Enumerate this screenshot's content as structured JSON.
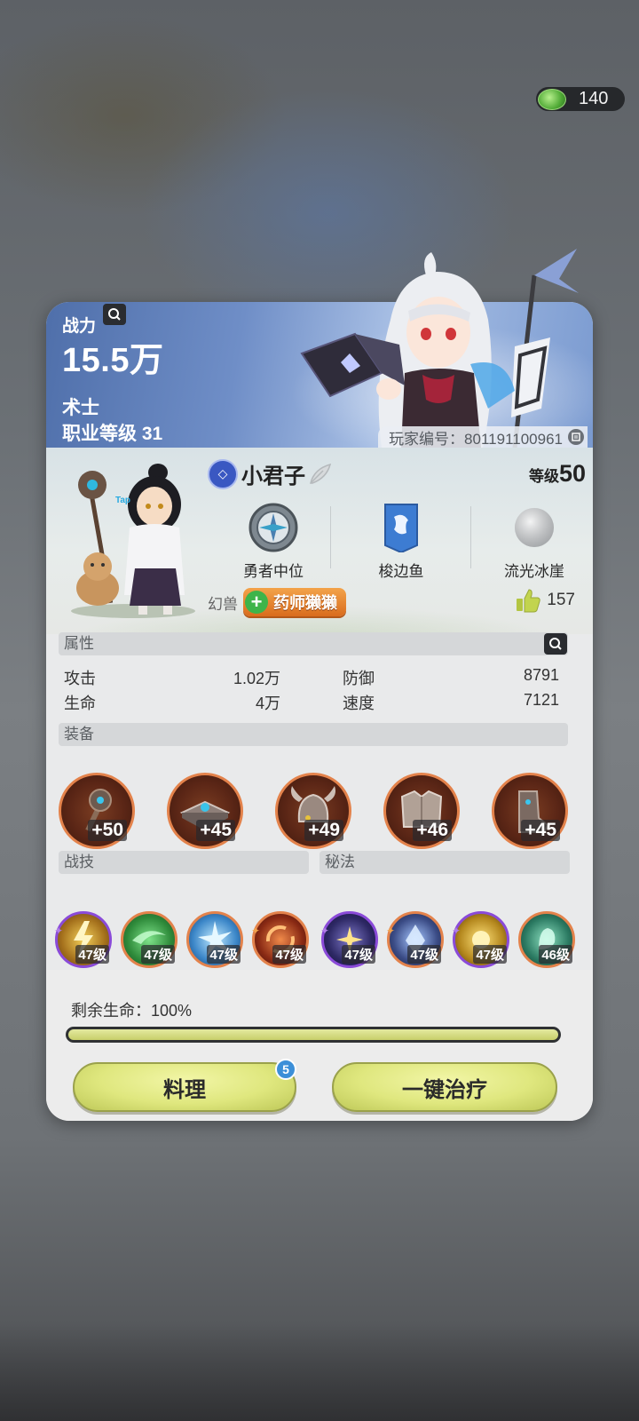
{
  "currency": {
    "amount": "140",
    "icon": "leaf-currency-icon"
  },
  "banner": {
    "power_label": "战力",
    "power_value": "15.5万",
    "class_name": "术士",
    "class_level": "职业等级 31",
    "player_id": "玩家编号：801191100961"
  },
  "profile": {
    "name": "小君子",
    "level_label": "等级",
    "level_value": "50",
    "badges": [
      {
        "label": "勇者中位",
        "icon": "rank-emblem-icon"
      },
      {
        "label": "梭边鱼",
        "icon": "guild-banner-icon"
      },
      {
        "label": "流光冰崖",
        "icon": "moon-orb-icon"
      }
    ],
    "pet_label": "幻兽",
    "pet_name": "药师獭獭",
    "likes": "157"
  },
  "attributes": {
    "title": "属性",
    "rows": [
      {
        "label": "攻击",
        "value": "1.02万"
      },
      {
        "label": "防御",
        "value": "8791"
      },
      {
        "label": "生命",
        "value": "4万"
      },
      {
        "label": "速度",
        "value": "7121"
      }
    ]
  },
  "equipment": {
    "title": "装备",
    "items": [
      {
        "level": "+50",
        "icon": "staff-weapon-icon"
      },
      {
        "level": "+45",
        "icon": "tome-offhand-icon"
      },
      {
        "level": "+49",
        "icon": "horned-helmet-icon"
      },
      {
        "level": "+46",
        "icon": "chest-armor-icon"
      },
      {
        "level": "+45",
        "icon": "boots-armor-icon"
      }
    ]
  },
  "skills": {
    "combat_title": "战技",
    "secret_title": "秘法",
    "items": [
      {
        "level": "47级",
        "icon": "lightning-skill-icon"
      },
      {
        "level": "47级",
        "icon": "wind-skill-icon"
      },
      {
        "level": "47级",
        "icon": "ice-burst-skill-icon"
      },
      {
        "level": "47级",
        "icon": "fire-vortex-skill-icon"
      },
      {
        "level": "47级",
        "icon": "starlight-skill-icon"
      },
      {
        "level": "47级",
        "icon": "crystal-skill-icon"
      },
      {
        "level": "47级",
        "icon": "sun-skill-icon"
      },
      {
        "level": "46级",
        "icon": "spirit-skill-icon"
      }
    ]
  },
  "health": {
    "label": "剩余生命：100%",
    "fraction": 1.0
  },
  "buttons": {
    "cook": "料理",
    "cook_badge": "5",
    "heal": "一键治疗"
  },
  "colors": {
    "equip_ring": "#e3824b",
    "epic_ring": "#8a4ad8",
    "button": "#dfe77e",
    "badge_blue": "#3c8fd8"
  }
}
